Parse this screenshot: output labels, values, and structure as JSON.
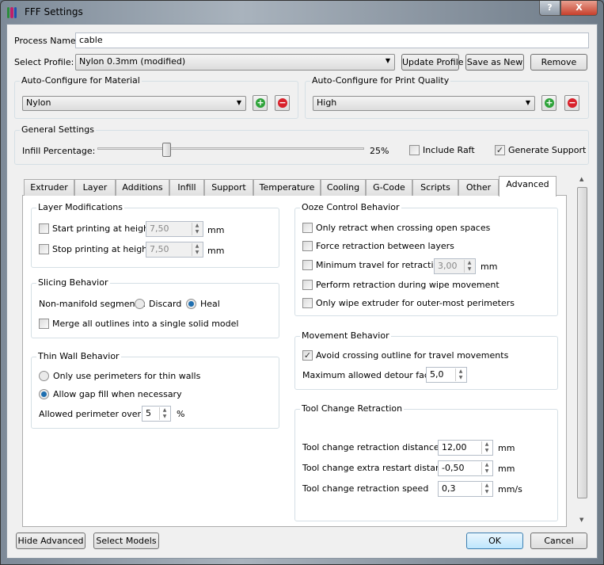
{
  "window": {
    "title": "FFF Settings",
    "help": "?",
    "close": "X"
  },
  "process": {
    "label": "Process Name:",
    "value": "cable"
  },
  "profile": {
    "label": "Select Profile:",
    "value": "Nylon 0.3mm (modified)",
    "update": "Update Profile",
    "save_new": "Save as New",
    "remove": "Remove"
  },
  "material": {
    "title": "Auto-Configure for Material",
    "value": "Nylon"
  },
  "quality": {
    "title": "Auto-Configure for Print Quality",
    "value": "High"
  },
  "general": {
    "title": "General Settings",
    "infill_label": "Infill Percentage:",
    "infill_value": "25%",
    "infill_fraction": 0.25,
    "raft": "Include Raft",
    "raft_checked": false,
    "support": "Generate Support",
    "support_checked": true
  },
  "tabs": [
    "Extruder",
    "Layer",
    "Additions",
    "Infill",
    "Support",
    "Temperature",
    "Cooling",
    "G-Code",
    "Scripts",
    "Other",
    "Advanced"
  ],
  "active_tab": "Advanced",
  "layer_mod": {
    "title": "Layer Modifications",
    "start": "Start printing at height",
    "start_value": "7,50",
    "stop": "Stop printing at height",
    "stop_value": "7,50",
    "unit": "mm"
  },
  "slicing": {
    "title": "Slicing Behavior",
    "nonmanifold": "Non-manifold segments:",
    "discard": "Discard",
    "heal": "Heal",
    "merge": "Merge all outlines into a single solid model"
  },
  "thinwall": {
    "title": "Thin Wall Behavior",
    "opt1": "Only use perimeters for thin walls",
    "opt2": "Allow gap fill when necessary",
    "overlap_label": "Allowed perimeter overlap",
    "overlap_value": "5",
    "overlap_unit": "%"
  },
  "ooze": {
    "title": "Ooze Control Behavior",
    "o1": "Only retract when crossing open spaces",
    "o2": "Force retraction between layers",
    "o3": "Minimum travel for retraction",
    "o3_value": "3,00",
    "o3_unit": "mm",
    "o4": "Perform retraction during wipe movement",
    "o5": "Only wipe extruder for outer-most perimeters"
  },
  "movement": {
    "title": "Movement Behavior",
    "avoid": "Avoid crossing outline for travel movements",
    "detour_label": "Maximum allowed detour factor",
    "detour_value": "5,0"
  },
  "toolchange": {
    "title": "Tool Change Retraction",
    "dist_label": "Tool change retraction distance",
    "dist_value": "12,00",
    "dist_unit": "mm",
    "extra_label": "Tool change extra restart distance",
    "extra_value": "-0,50",
    "extra_unit": "mm",
    "speed_label": "Tool change retraction speed",
    "speed_value": "0,3",
    "speed_unit": "mm/s"
  },
  "footer": {
    "hide_advanced": "Hide Advanced",
    "select_models": "Select Models",
    "ok": "OK",
    "cancel": "Cancel"
  }
}
